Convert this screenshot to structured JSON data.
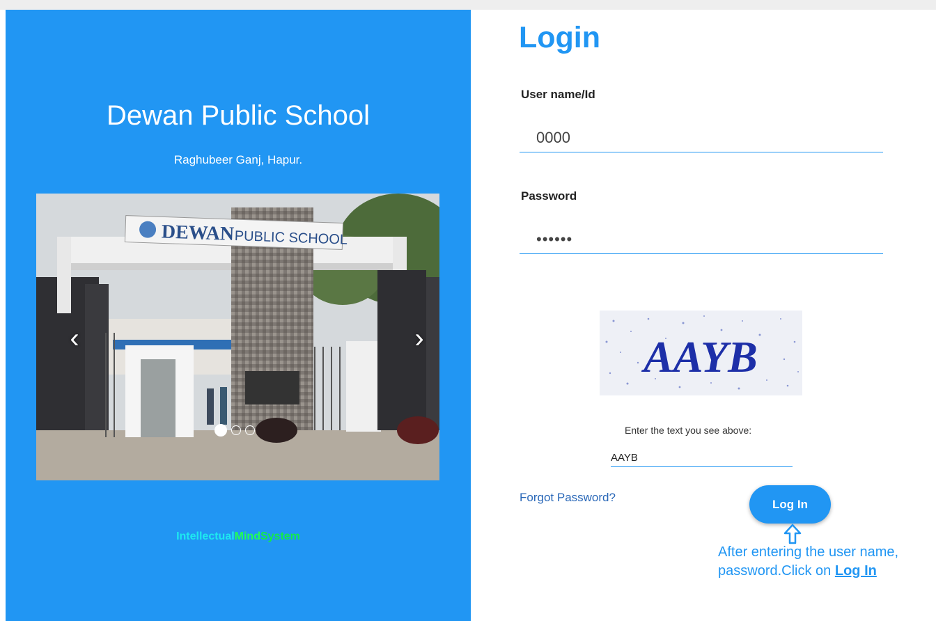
{
  "school": {
    "name": "Dewan Public School",
    "address": "Raghubeer Ganj, Hapur."
  },
  "carousel": {
    "prev_icon": "chevron-left-icon",
    "next_icon": "chevron-right-icon",
    "prev_glyph": "‹",
    "next_glyph": "›",
    "slide_count": 3,
    "active_index": 0,
    "banner": {
      "word1": "DEWAN",
      "word2": "PUBLIC SCHOOL"
    }
  },
  "brand": {
    "part1": "Intellectual",
    "part2": "Mind",
    "part3": "System"
  },
  "login": {
    "title": "Login",
    "username_label": "User name/Id",
    "username_value": "0000",
    "password_label": "Password",
    "password_value": "••••••",
    "captcha_text": "AAYB",
    "captcha_instruction": "Enter the text you see above:",
    "captcha_value": "AAYB",
    "forgot_password": "Forgot Password?",
    "login_button": "Log In"
  },
  "annotation": {
    "line1": "After entering the user name,",
    "line2_prefix": "password.Click on",
    "line2_link": "Log In",
    "arrow_icon": "up-arrow-icon"
  },
  "colors": {
    "primary": "#2196f3",
    "brand_cyan": "#1de9f0",
    "brand_green": "#22ff55"
  }
}
